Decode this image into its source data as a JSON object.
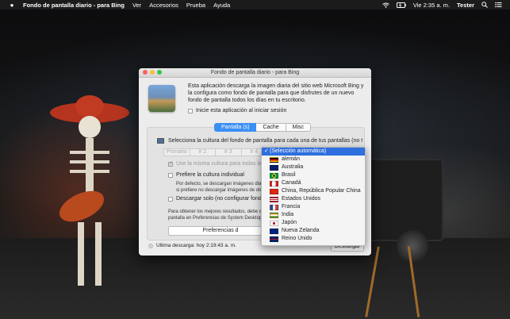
{
  "menubar": {
    "apple": "",
    "app_name": "Fondo de pantalla diario - para Bing",
    "menus": [
      "Ver",
      "Accesorios",
      "Prueba",
      "Ayuda"
    ],
    "clock": "Vie 2:35 a. m.",
    "user": "Tester"
  },
  "window": {
    "title": "Fondo de pantalla diario - para Bing",
    "description": "Esta aplicación descarga la imagen diaria del sitio web Microsoft Bing y la configura como fondo de pantalla para que disfrutes de un nuevo fondo de pantalla todos los días en tu escritorio.",
    "startup_label": "Inicie esta aplicación al iniciar sesión",
    "tabs": [
      "Pantalla (s)",
      "Cache",
      "Misc"
    ],
    "panel": {
      "culture_label": "Selecciona la cultura del fondo de pantalla para cada una de tus pantallas (no t",
      "screens": [
        "Primario",
        "# 2",
        "# 3",
        "# 4"
      ],
      "same_culture_label": "Use la misma cultura para todas las",
      "individual_label": "Prefiere la cultura individual",
      "individual_note_1": "Por defecto, se descargan imágenes diar",
      "individual_note_2": "si prefiere no descargar imágenes de otr",
      "download_only_label": "Descargar solo (no configurar fondo",
      "tip_1": "Para obtener los mejores resultados, debe c",
      "tip_2": "pantalla en Preferencias de System Desktop",
      "prefs_button": "Preferencias d"
    },
    "last_download": "Ultima descarga: hoy 2:19:43 a. m.",
    "download_button": "Descargar"
  },
  "dropdown": {
    "selected": "(Selección automática)",
    "items": [
      {
        "label": "alemán",
        "flag": "germany-flag"
      },
      {
        "label": "Australia",
        "flag": "australia-flag"
      },
      {
        "label": "Brasil",
        "flag": "brazil-flag"
      },
      {
        "label": "Canadá",
        "flag": "canada-flag"
      },
      {
        "label": "China, República Popular China",
        "flag": "china-flag"
      },
      {
        "label": "Estados Unidos",
        "flag": "usa-flag"
      },
      {
        "label": "Francia",
        "flag": "france-flag"
      },
      {
        "label": "India",
        "flag": "india-flag"
      },
      {
        "label": "Japón",
        "flag": "japan-flag"
      },
      {
        "label": "Nueva Zelanda",
        "flag": "new-zealand-flag"
      },
      {
        "label": "Reino Unido",
        "flag": "uk-flag"
      }
    ]
  },
  "colors": {
    "accent": "#3b8ff3",
    "selection": "#2f6fde",
    "menubar": "#1b1b1c",
    "close": "#fc605b",
    "minimize": "#fdbc40",
    "zoom": "#34c84a"
  }
}
